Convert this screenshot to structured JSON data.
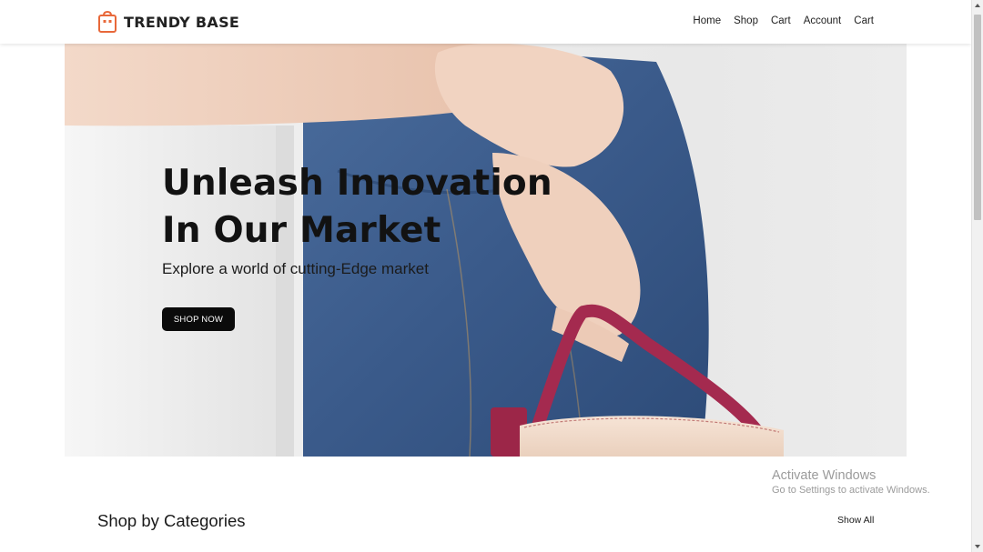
{
  "brand": {
    "name": "TRENDY BASE",
    "logo_icon": "shopping-bag-icon",
    "logo_color": "#e8683a"
  },
  "nav": {
    "items": [
      {
        "label": "Home"
      },
      {
        "label": "Shop"
      },
      {
        "label": "Cart"
      },
      {
        "label": "Account"
      },
      {
        "label": "Cart"
      }
    ]
  },
  "hero": {
    "title_line1": "Unleash Innovation",
    "title_line2": "In Our Market",
    "subtitle": "Explore a world of cutting-Edge market",
    "cta_label": "SHOP NOW"
  },
  "categories": {
    "title": "Shop by Categories",
    "show_all_label": "Show All"
  },
  "watermark": {
    "title": "Activate Windows",
    "subtitle": "Go to Settings to activate Windows."
  },
  "colors": {
    "accent": "#e8683a",
    "cta_bg": "#0b0b0b",
    "denim": "#3f5f8f",
    "bag_strap": "#a42a4f"
  }
}
